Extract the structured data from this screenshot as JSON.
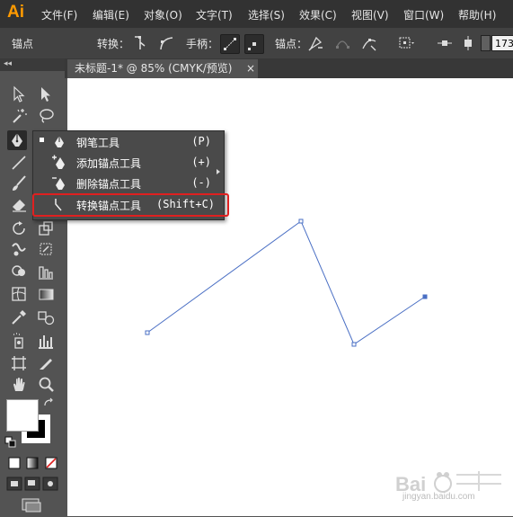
{
  "app": {
    "logo": "Ai"
  },
  "menu": [
    "文件(F)",
    "编辑(E)",
    "对象(O)",
    "文字(T)",
    "选择(S)",
    "效果(C)",
    "视图(V)",
    "窗口(W)",
    "帮助(H)"
  ],
  "control_bar": {
    "mode_label": "锚点",
    "convert_label": "转换：",
    "handles_label": "手柄：",
    "anchor_label": "锚点：",
    "size_value": "173"
  },
  "document": {
    "tab_title": "未标题-1* @ 85% (CMYK/预览)",
    "close": "×"
  },
  "toolbox": {
    "collapse": "◂◂"
  },
  "flyout": {
    "items": [
      {
        "label": "钢笔工具",
        "shortcut": "(P)",
        "icon": "pen-icon",
        "active": true
      },
      {
        "label": "添加锚点工具",
        "shortcut": "(+)",
        "icon": "add-anchor-point-icon"
      },
      {
        "label": "删除锚点工具",
        "shortcut": "(-)",
        "icon": "delete-anchor-point-icon"
      },
      {
        "label": "转换锚点工具",
        "shortcut": "(Shift+C)",
        "icon": "convert-anchor-point-icon"
      }
    ],
    "highlight_color": "#e02020"
  },
  "path": {
    "stroke_color": "#4a6fc4"
  },
  "watermark": {
    "text": "jingyan.baidu.com",
    "brand": "Bai 经验"
  }
}
